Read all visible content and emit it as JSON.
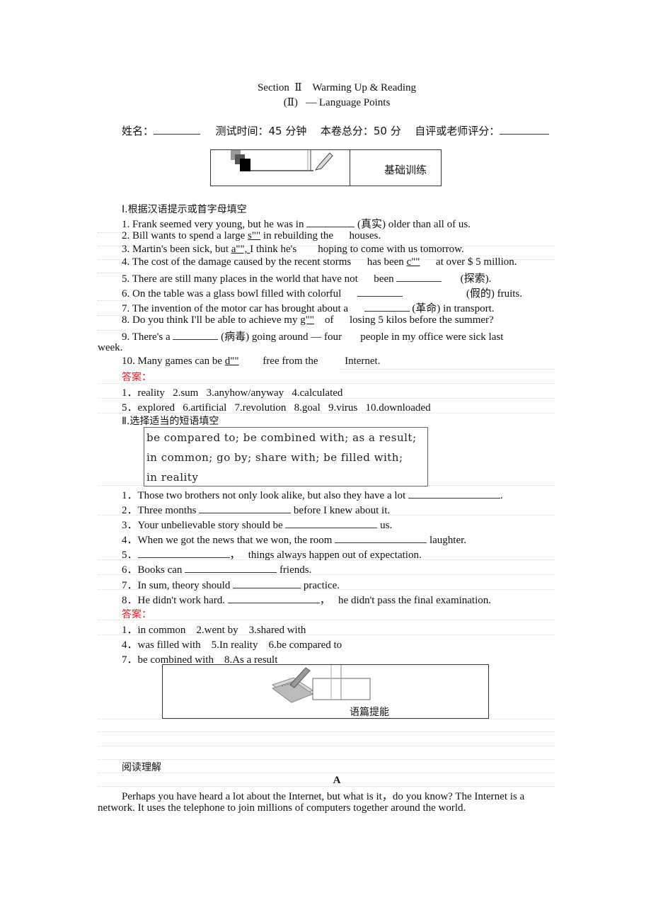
{
  "header": {
    "title_line1": "Section  Ⅱ    Warming Up & Reading",
    "title_line2": "(Ⅱ)   — Language Points",
    "info": {
      "name_label": "姓名：",
      "time_label": "测试时间：45 分钟",
      "total_label": "本卷总分：50 分",
      "score_label": "自评或老师评分："
    }
  },
  "banner1": {
    "label": "基础训练",
    "icon": "pencil-blocks-icon"
  },
  "part1": {
    "heading": "Ⅰ.根据汉语提示或首字母填空",
    "items": [
      {
        "pre": "1. Frank seemed very young, but he was in ",
        "hint": "(真实)",
        "post": " older than all of us."
      },
      {
        "pre": "2. Bill wants to spend a large ",
        "initial": "s\"\"",
        "post": " in rebuilding the      houses."
      },
      {
        "pre": "3. Martin's been sick, but ",
        "initial": "a\"\", ",
        "post": "I think he's        hoping to come with us tomorrow."
      },
      {
        "pre": "4. The cost of the damage caused by the recent storms      has been ",
        "initial": "c\"\"",
        "post": "      at over $ 5 million."
      },
      {
        "pre": "5. There are still many places in the world that have not      been ",
        "hint": "(探索)",
        "post": "."
      },
      {
        "pre": "6. On the table was a glass bowl filled with colorful",
        "hint": "(假的)",
        "post": " fruits."
      },
      {
        "pre": "7. The invention of the motor car has brought about a",
        "hint": "(革命)",
        "post": " in transport."
      },
      {
        "pre": "8. Do you think I'll be able to achieve my ",
        "initial": "g\"\"",
        "post": "    of      losing 5 kilos before the summer?"
      },
      {
        "pre": "9. There's a ",
        "hint": "(病毒)",
        "post": " going around — four       people in my office were sick last",
        "wrap": "week."
      },
      {
        "pre": "10. Many games can be ",
        "initial": "d\"\"",
        "post": "         free from the          Internet."
      }
    ],
    "answer_label": "答案：",
    "answers": [
      "1．reality   2.sum   3.anyhow/anyway   4.calculated",
      "5．explored   6.artificial   7.revolution   8.goal   9.virus   10.downloaded"
    ]
  },
  "part2": {
    "heading": "Ⅱ.选择适当的短语填空",
    "phrase_lines": [
      "be compared to; be combined with; as a result;",
      "in common; go by; share with; be filled with;",
      "in reality"
    ],
    "items": [
      {
        "num": "1．",
        "pre": "Those two brothers not only look alike, but also they have a lot ",
        "post": "."
      },
      {
        "num": "2．",
        "pre": "Three months ",
        "post": " before I knew about it."
      },
      {
        "num": "3．",
        "pre": "Your unbelievable story should be ",
        "post": " us."
      },
      {
        "num": "4．",
        "pre": "When we got the news that we won, the room ",
        "post": " laughter."
      },
      {
        "num": "5．",
        "pre": "",
        "post": "，   things always happen out of expectation."
      },
      {
        "num": "6．",
        "pre": "Books can ",
        "post": " friends."
      },
      {
        "num": "7．",
        "pre": "In sum, theory should ",
        "post": " practice."
      },
      {
        "num": "8．",
        "pre": "He didn't work hard. ",
        "post": "，   he didn't pass the final examination."
      }
    ],
    "answer_label": "答案：",
    "answers": [
      "1．in common    2.went by    3.shared with",
      "4．was filled with    5.In reality    6.be compared to",
      "7．be combined with    8.As a result"
    ]
  },
  "banner2": {
    "label": "语篇提能",
    "icon": "notebook-pen-icon"
  },
  "reading": {
    "heading": "阅读理解",
    "passage_label": "A",
    "paragraph_line1": "Perhaps you have heard a lot about the Internet, but what is it，do you know? The Internet is a",
    "paragraph_line2": "network. It uses the telephone to join millions of computers together around the world."
  },
  "colors": {
    "answer_red": "#e8151b",
    "text": "#111111"
  }
}
